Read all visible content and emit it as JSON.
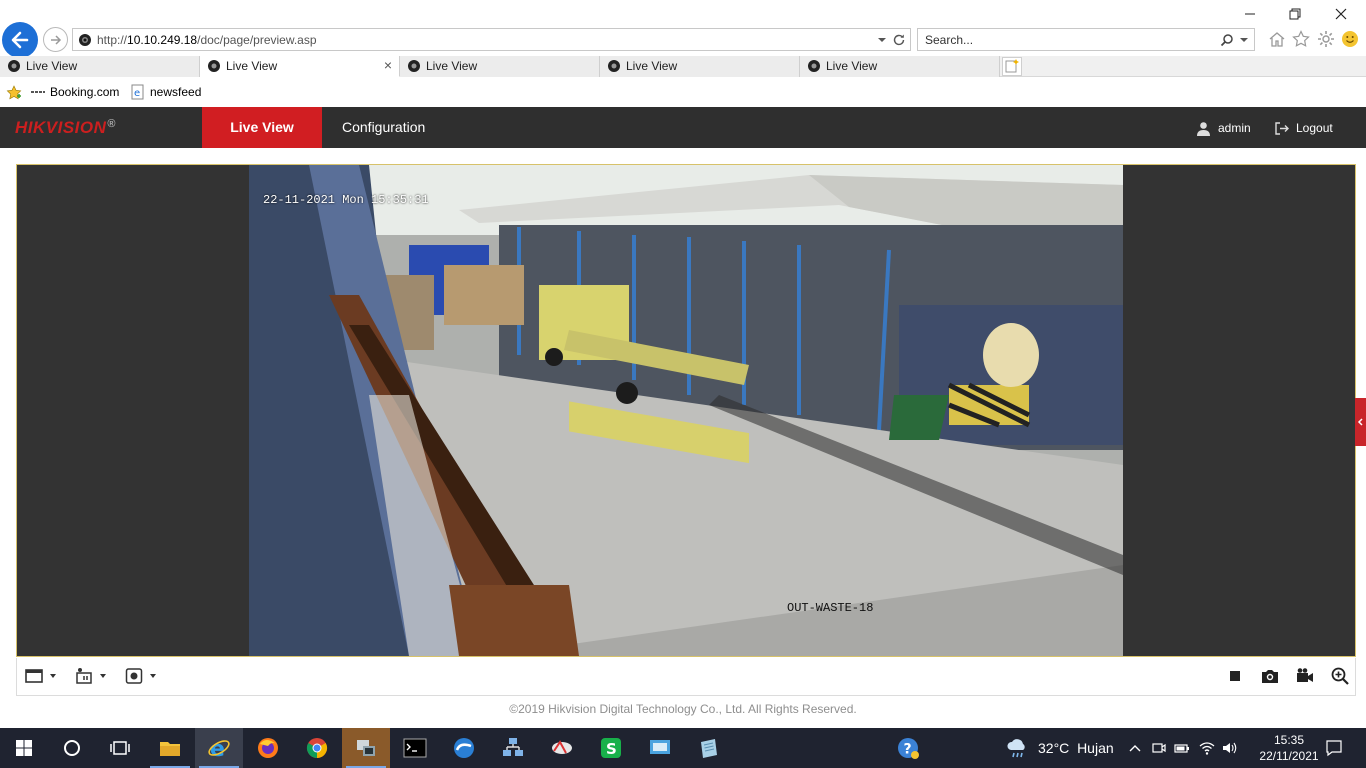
{
  "browser": {
    "address_prefix": "http://",
    "address_host": "10.10.249.18",
    "address_path": "/doc/page/preview.asp",
    "search_placeholder": "Search...",
    "tabs": [
      {
        "label": "Live View",
        "active": false
      },
      {
        "label": "Live View",
        "active": true
      },
      {
        "label": "Live View",
        "active": false
      },
      {
        "label": "Live View",
        "active": false
      },
      {
        "label": "Live View",
        "active": false
      }
    ],
    "favorites": [
      {
        "label": "Booking.com",
        "icon": "booking-icon"
      },
      {
        "label": "newsfeed",
        "icon": "ie-page-icon"
      }
    ]
  },
  "hikvision": {
    "logo": "HIKVISION",
    "logo_mark": "®",
    "nav": {
      "live_view": "Live View",
      "configuration": "Configuration"
    },
    "user": "admin",
    "logout": "Logout",
    "osd_time": "22-11-2021 Mon 15:35:31",
    "osd_camera_name": "OUT-WASTE-18",
    "footer": "©2019 Hikvision Digital Technology Co., Ltd. All Rights Reserved.",
    "accent_color": "#d11e22"
  },
  "taskbar": {
    "apps": [
      "start-icon",
      "search-circle-icon",
      "task-view-icon",
      "file-explorer-icon",
      "internet-explorer-icon",
      "firefox-icon",
      "chrome-icon",
      "remote-app-icon",
      "cmd-icon",
      "edge-like-icon",
      "network-app-icon",
      "satellite-app-icon",
      "wps-icon",
      "monitor-app-icon",
      "notes-app-icon"
    ],
    "help_icon": "help-icon",
    "weather_temp": "32°C",
    "weather_text": "Hujan",
    "time": "15:35",
    "date": "22/11/2021"
  }
}
